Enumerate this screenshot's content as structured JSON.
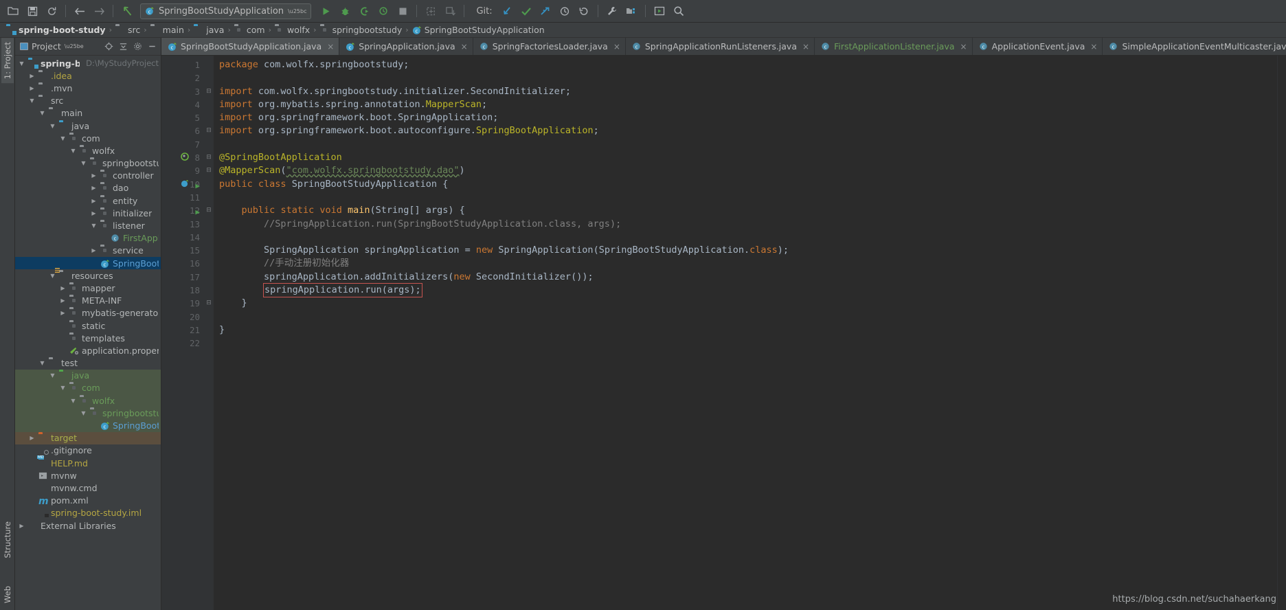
{
  "toolbar": {
    "icons": [
      {
        "name": "open-folder-icon",
        "glyph": "⬚"
      },
      {
        "name": "save-all-icon",
        "glyph": "💾"
      },
      {
        "name": "sync-icon",
        "glyph": "↻"
      },
      {
        "name": "back-icon",
        "glyph": "←"
      },
      {
        "name": "forward-icon",
        "glyph": "→"
      },
      {
        "name": "jump-to-source-icon",
        "glyph": "↖"
      }
    ],
    "run_config_name": "SpringBootStudyApplication",
    "run_label": "Run",
    "debug_label": "Debug",
    "run_coverage_label": "Run with Coverage",
    "profile_label": "Profile",
    "stop_label": "Stop",
    "git_label": "Git:",
    "git_update_label": "Update Project",
    "git_commit_label": "Commit",
    "git_push_label": "Push",
    "git_history_label": "History",
    "git_revert_label": "Rollback",
    "settings_label": "Settings",
    "project-structure_label": "Project Structure",
    "select-opened-file_label": "Select Opened File",
    "search-label": "Search Everywhere"
  },
  "breadcrumb": {
    "items": [
      {
        "label": "spring-boot-study",
        "icon": "module-icon",
        "bold": true
      },
      {
        "label": "src",
        "icon": "folder-icon",
        "bold": false
      },
      {
        "label": "main",
        "icon": "folder-icon",
        "bold": false
      },
      {
        "label": "java",
        "icon": "source-folder-icon",
        "bold": false
      },
      {
        "label": "com",
        "icon": "package-icon",
        "bold": false
      },
      {
        "label": "wolfx",
        "icon": "package-icon",
        "bold": false
      },
      {
        "label": "springbootstudy",
        "icon": "package-icon",
        "bold": false
      },
      {
        "label": "SpringBootStudyApplication",
        "icon": "spring-class-icon",
        "bold": false
      }
    ],
    "separator": "›"
  },
  "rail": {
    "left_top": "1: Project",
    "left_structure": "Structure",
    "left_web": "Web"
  },
  "project_pane": {
    "title": "Project",
    "caret": "▾",
    "header_icons": [
      {
        "name": "locate-icon",
        "glyph": "⊕"
      },
      {
        "name": "collapse-all-icon",
        "glyph": "⤓"
      },
      {
        "name": "settings-gear-icon",
        "glyph": "⚙"
      },
      {
        "name": "hide-panel-icon",
        "glyph": "−"
      }
    ],
    "tree": [
      {
        "depth": 0,
        "arrow": "▼",
        "icon": "module-folder",
        "label": "spring-boot-study",
        "style": "bold",
        "suffix": "D:\\MyStudyProject"
      },
      {
        "depth": 1,
        "arrow": "▶",
        "icon": "folder",
        "label": ".idea",
        "style": "yellow",
        "suffix": ""
      },
      {
        "depth": 1,
        "arrow": "▶",
        "icon": "folder",
        "label": ".mvn",
        "style": "",
        "suffix": ""
      },
      {
        "depth": 1,
        "arrow": "▼",
        "icon": "folder",
        "label": "src",
        "style": "",
        "suffix": ""
      },
      {
        "depth": 2,
        "arrow": "▼",
        "icon": "folder",
        "label": "main",
        "style": "",
        "suffix": ""
      },
      {
        "depth": 3,
        "arrow": "▼",
        "icon": "folder-blue",
        "label": "java",
        "style": "",
        "suffix": ""
      },
      {
        "depth": 4,
        "arrow": "▼",
        "icon": "package",
        "label": "com",
        "style": "",
        "suffix": ""
      },
      {
        "depth": 5,
        "arrow": "▼",
        "icon": "package",
        "label": "wolfx",
        "style": "",
        "suffix": ""
      },
      {
        "depth": 6,
        "arrow": "▼",
        "icon": "package",
        "label": "springbootstudy",
        "style": "",
        "suffix": ""
      },
      {
        "depth": 7,
        "arrow": "▶",
        "icon": "package",
        "label": "controller",
        "style": "",
        "suffix": ""
      },
      {
        "depth": 7,
        "arrow": "▶",
        "icon": "package",
        "label": "dao",
        "style": "",
        "suffix": ""
      },
      {
        "depth": 7,
        "arrow": "▶",
        "icon": "package",
        "label": "entity",
        "style": "",
        "suffix": ""
      },
      {
        "depth": 7,
        "arrow": "▶",
        "icon": "package",
        "label": "initializer",
        "style": "",
        "suffix": ""
      },
      {
        "depth": 7,
        "arrow": "▼",
        "icon": "package",
        "label": "listener",
        "style": "",
        "suffix": ""
      },
      {
        "depth": 8,
        "arrow": "",
        "icon": "class-circle",
        "label": "FirstApplicationListener",
        "style": "green",
        "suffix": ""
      },
      {
        "depth": 7,
        "arrow": "▶",
        "icon": "package",
        "label": "service",
        "style": "",
        "suffix": ""
      },
      {
        "depth": 7,
        "arrow": "",
        "icon": "spring-class",
        "label": "SpringBootStudyApplication",
        "style": "blue selected",
        "suffix": ""
      },
      {
        "depth": 3,
        "arrow": "▼",
        "icon": "resources-folder",
        "label": "resources",
        "style": "",
        "suffix": ""
      },
      {
        "depth": 4,
        "arrow": "▶",
        "icon": "package",
        "label": "mapper",
        "style": "",
        "suffix": ""
      },
      {
        "depth": 4,
        "arrow": "▶",
        "icon": "package",
        "label": "META-INF",
        "style": "",
        "suffix": ""
      },
      {
        "depth": 4,
        "arrow": "▶",
        "icon": "package",
        "label": "mybatis-generator",
        "style": "",
        "suffix": ""
      },
      {
        "depth": 4,
        "arrow": "",
        "icon": "package",
        "label": "static",
        "style": "",
        "suffix": ""
      },
      {
        "depth": 4,
        "arrow": "",
        "icon": "package",
        "label": "templates",
        "style": "",
        "suffix": ""
      },
      {
        "depth": 4,
        "arrow": "",
        "icon": "properties-file",
        "label": "application.properties",
        "style": "",
        "suffix": ""
      },
      {
        "depth": 2,
        "arrow": "▼",
        "icon": "folder",
        "label": "test",
        "style": "",
        "suffix": ""
      },
      {
        "depth": 3,
        "arrow": "▼",
        "icon": "folder-green",
        "label": "java",
        "style": "srcgreen",
        "suffix": ""
      },
      {
        "depth": 4,
        "arrow": "▼",
        "icon": "package",
        "label": "com",
        "style": "srcgreen",
        "suffix": ""
      },
      {
        "depth": 5,
        "arrow": "▼",
        "icon": "package",
        "label": "wolfx",
        "style": "srcgreen",
        "suffix": ""
      },
      {
        "depth": 6,
        "arrow": "▼",
        "icon": "package",
        "label": "springbootstudy",
        "style": "srcgreen",
        "suffix": ""
      },
      {
        "depth": 7,
        "arrow": "",
        "icon": "spring-class",
        "label": "SpringBootStudyApplicationTests",
        "style": "blue srcgreen",
        "suffix": ""
      },
      {
        "depth": 1,
        "arrow": "▶",
        "icon": "folder-orange",
        "label": "target",
        "style": "tan tgtbrown",
        "suffix": ""
      },
      {
        "depth": 1,
        "arrow": "",
        "icon": "gitignore-file",
        "label": ".gitignore",
        "style": "",
        "suffix": ""
      },
      {
        "depth": 1,
        "arrow": "",
        "icon": "md-file",
        "label": "HELP.md",
        "style": "yellow",
        "suffix": ""
      },
      {
        "depth": 1,
        "arrow": "",
        "icon": "script-file",
        "label": "mvnw",
        "style": "",
        "suffix": ""
      },
      {
        "depth": 1,
        "arrow": "",
        "icon": "cmd-file",
        "label": "mvnw.cmd",
        "style": "",
        "suffix": ""
      },
      {
        "depth": 1,
        "arrow": "",
        "icon": "maven-file",
        "label": "pom.xml",
        "style": "",
        "suffix": ""
      },
      {
        "depth": 1,
        "arrow": "",
        "icon": "iml-file",
        "label": "spring-boot-study.iml",
        "style": "yellow",
        "suffix": ""
      },
      {
        "depth": 0,
        "arrow": "▶",
        "icon": "libraries",
        "label": "External Libraries",
        "style": "",
        "suffix": ""
      },
      {
        "depth": 0,
        "arrow": "",
        "icon": "scratches",
        "label": "",
        "style": "",
        "suffix": ""
      }
    ]
  },
  "editor_tabs": {
    "tabs": [
      {
        "label": "SpringBootStudyApplication.java",
        "icon": "spring-class-icon",
        "active": true,
        "green": false
      },
      {
        "label": "SpringApplication.java",
        "icon": "spring-class-icon",
        "active": false,
        "green": false
      },
      {
        "label": "SpringFactoriesLoader.java",
        "icon": "class-icon",
        "active": false,
        "green": false
      },
      {
        "label": "SpringApplicationRunListeners.java",
        "icon": "class-icon",
        "active": false,
        "green": false
      },
      {
        "label": "FirstApplicationListener.java",
        "icon": "class-icon",
        "active": false,
        "green": true
      },
      {
        "label": "ApplicationEvent.java",
        "icon": "class-icon",
        "active": false,
        "green": false
      },
      {
        "label": "SimpleApplicationEventMulticaster.java",
        "icon": "class-icon",
        "active": false,
        "green": false
      }
    ],
    "close_glyph": "×",
    "overflow_glyph": "▾≡"
  },
  "editor": {
    "file_name": "SpringBootStudyApplication.java",
    "lines": [
      {
        "n": 1,
        "text": "package com.wolfx.springbootstudy;"
      },
      {
        "n": 2,
        "text": ""
      },
      {
        "n": 3,
        "text": "import com.wolfx.springbootstudy.initializer.SecondInitializer;"
      },
      {
        "n": 4,
        "text": "import org.mybatis.spring.annotation.MapperScan;"
      },
      {
        "n": 5,
        "text": "import org.springframework.boot.SpringApplication;"
      },
      {
        "n": 6,
        "text": "import org.springframework.boot.autoconfigure.SpringBootApplication;"
      },
      {
        "n": 7,
        "text": ""
      },
      {
        "n": 8,
        "text": "@SpringBootApplication"
      },
      {
        "n": 9,
        "text": "@MapperScan(\"com.wolfx.springbootstudy.dao\")"
      },
      {
        "n": 10,
        "text": "public class SpringBootStudyApplication {"
      },
      {
        "n": 11,
        "text": ""
      },
      {
        "n": 12,
        "text": "    public static void main(String[] args) {"
      },
      {
        "n": 13,
        "text": "        //SpringApplication.run(SpringBootStudyApplication.class, args);"
      },
      {
        "n": 14,
        "text": ""
      },
      {
        "n": 15,
        "text": "        SpringApplication springApplication = new SpringApplication(SpringBootStudyApplication.class);"
      },
      {
        "n": 16,
        "text": "        //手动注册初始化器"
      },
      {
        "n": 17,
        "text": "        springApplication.addInitializers(new SecondInitializer());"
      },
      {
        "n": 18,
        "text": "        springApplication.run(args);"
      },
      {
        "n": 19,
        "text": "    }"
      },
      {
        "n": 20,
        "text": ""
      },
      {
        "n": 21,
        "text": "}"
      },
      {
        "n": 22,
        "text": ""
      }
    ],
    "highlighted_line": 18,
    "highlighted_text": "springApplication.run(args);",
    "gutter_markers": [
      {
        "line": 8,
        "name": "spring-bean-icon"
      },
      {
        "line": 10,
        "name": "spring-boot-run-icon"
      },
      {
        "line": 10,
        "name": "run-gutter-arrow-icon"
      },
      {
        "line": 12,
        "name": "run-gutter-arrow-icon"
      }
    ],
    "fold_markers": [
      3,
      6,
      8,
      9,
      12,
      19
    ]
  },
  "watermark": "https://blog.csdn.net/suchahaerkang"
}
